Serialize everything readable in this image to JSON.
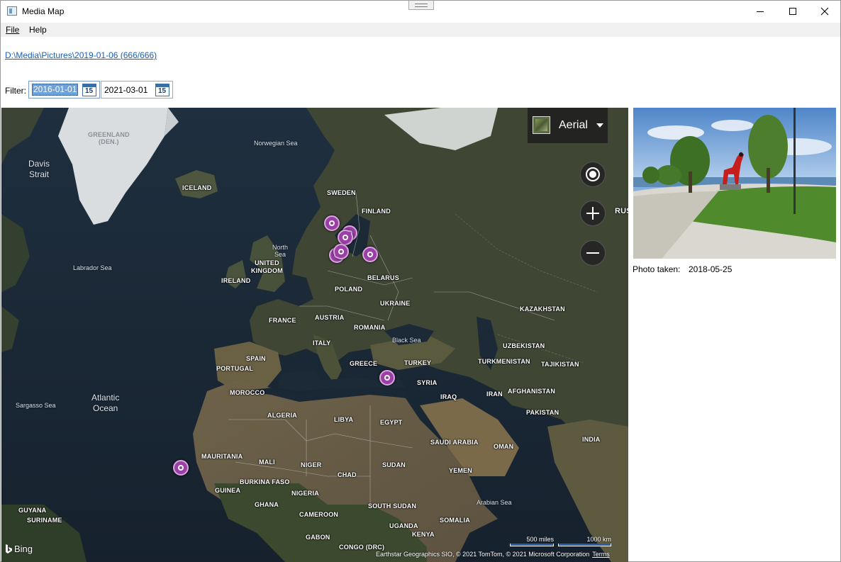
{
  "window": {
    "title": "Media Map"
  },
  "menu": {
    "file": "File",
    "help": "Help"
  },
  "folder": {
    "link": "D:\\Media\\Pictures\\2019-01-06 (666/666)"
  },
  "filter": {
    "label": "Filter:",
    "from": "2016-01-01",
    "to": "2021-03-01",
    "calendar_icon_text": "15"
  },
  "map": {
    "type_label": "Aerial",
    "controls": [
      "locate-icon",
      "zoom-in-icon",
      "zoom-out-icon"
    ],
    "countries": {
      "greenland": "GREENLAND",
      "greenland_sub": "(DEN.)",
      "iceland": "ICELAND",
      "sweden": "SWEDEN",
      "finland": "FINLAND",
      "russia": "RUS",
      "uk1": "UNITED",
      "uk2": "KINGDOM",
      "ireland": "IRELAND",
      "belarus": "BELARUS",
      "poland": "POLAND",
      "ukraine": "UKRAINE",
      "kazakhstan": "KAZAKHSTAN",
      "france": "FRANCE",
      "austria": "AUSTRIA",
      "romania": "ROMANIA",
      "italy": "ITALY",
      "uzbekistan": "UZBEKISTAN",
      "spain": "SPAIN",
      "portugal": "PORTUGAL",
      "greece": "GREECE",
      "turkey": "TURKEY",
      "turkmenistan": "TURKMENISTAN",
      "tajikistan": "TAJIKISTAN",
      "syria": "SYRIA",
      "morocco": "MOROCCO",
      "iraq": "IRAQ",
      "iran": "IRAN",
      "afghanistan": "AFGHANISTAN",
      "algeria": "ALGERIA",
      "libya": "LIBYA",
      "egypt": "EGYPT",
      "pakistan": "PAKISTAN",
      "saudi": "SAUDI ARABIA",
      "oman": "OMAN",
      "india": "INDIA",
      "mauritania": "MAURITANIA",
      "mali": "MALI",
      "niger": "NIGER",
      "chad": "CHAD",
      "sudan": "SUDAN",
      "yemen": "YEMEN",
      "burkina": "BURKINA FASO",
      "guinea": "GUINEA",
      "nigeria": "NIGERIA",
      "ghana": "GHANA",
      "guyana": "GUYANA",
      "suriname": "SURINAME",
      "cameroon": "CAMEROON",
      "south_sudan": "SOUTH SUDAN",
      "somalia": "SOMALIA",
      "uganda": "UGANDA",
      "kenya": "KENYA",
      "gabon": "GABON",
      "congo": "CONGO (DRC)"
    },
    "seas": {
      "davis1": "Davis",
      "davis2": "Strait",
      "norwegian": "Norwegian Sea",
      "north_sea1": "North",
      "north_sea2": "Sea",
      "labrador": "Labrador Sea",
      "black_sea": "Black Sea",
      "atlantic1": "Atlantic",
      "atlantic2": "Ocean",
      "sargasso": "Sargasso Sea",
      "arabian": "Arabian Sea"
    },
    "bing": "Bing",
    "scale_miles": "500 miles",
    "scale_km": "1000 km",
    "copyright": "Earthstar Geographics SIO, © 2021 TomTom, © 2021 Microsoft Corporation",
    "terms": "Terms",
    "pin_color": "#9b3fa6"
  },
  "photo": {
    "taken_label": "Photo taken:",
    "taken_value": "2018-05-25"
  }
}
